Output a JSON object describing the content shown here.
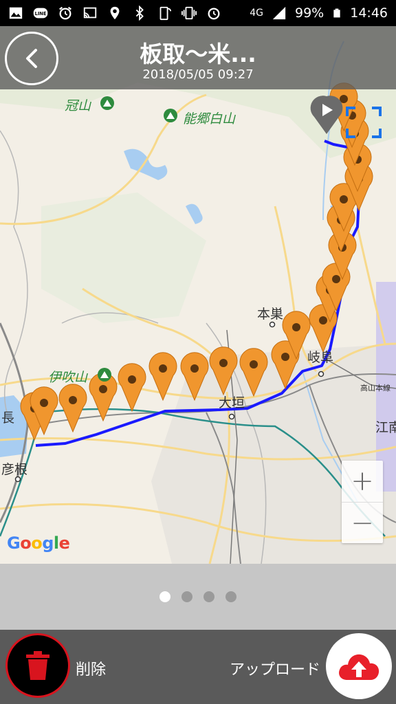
{
  "status_bar": {
    "icons_left": [
      "image-icon",
      "line-app-icon",
      "alarm-icon",
      "cast-icon",
      "location-icon",
      "bluetooth-icon",
      "phone-signal-icon",
      "vibrate-icon",
      "alarm-clock-icon"
    ],
    "network": "4G",
    "battery": "99%",
    "time": "14:46"
  },
  "header": {
    "title": "板取〜米...",
    "datetime": "2018/05/05 09:27"
  },
  "map": {
    "labels": {
      "kanmuriyama": "冠山",
      "nogo_hakusan": "能郷白山",
      "motosu": "本巣",
      "ibukiyama": "伊吹山",
      "ogaki": "大垣",
      "gifu": "岐阜",
      "takayama_line": "高山本線",
      "konan": "江南",
      "hikone": "彦根",
      "nagahama": "長"
    },
    "google_logo": {
      "letters": [
        "G",
        "o",
        "o",
        "g",
        "l",
        "e"
      ],
      "colors": [
        "#4285f4",
        "#ea4335",
        "#fbbc05",
        "#4285f4",
        "#34a853",
        "#ea4335"
      ]
    },
    "zoom_in": "+",
    "zoom_out": "−",
    "route_color": "#1a1aff",
    "marker_color": "#f0962e",
    "photo_markers": 22
  },
  "pager": {
    "pages": 4,
    "active": 0
  },
  "bottom_bar": {
    "delete_label": "削除",
    "upload_label": "アップロード",
    "delete_color": "#d8141e",
    "upload_color": "#e8202a"
  }
}
